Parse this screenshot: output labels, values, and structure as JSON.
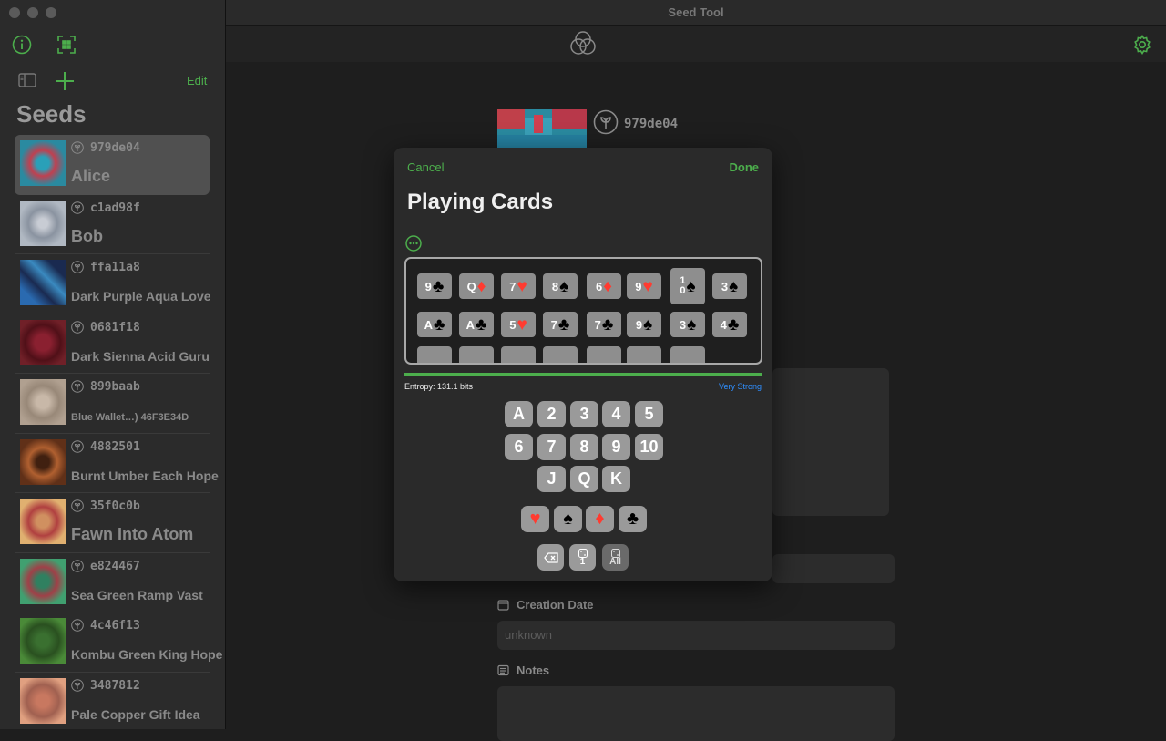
{
  "window": {
    "title": "Seed Tool"
  },
  "sidebar": {
    "edit_label": "Edit",
    "title": "Seeds",
    "items": [
      {
        "id": "979de04",
        "name": "Alice",
        "selected": true,
        "size": "big"
      },
      {
        "id": "c1ad98f",
        "name": "Bob",
        "size": "big"
      },
      {
        "id": "ffa11a8",
        "name": "Dark Purple Aqua Love",
        "size": "normal"
      },
      {
        "id": "0681f18",
        "name": "Dark Sienna Acid Guru",
        "size": "normal"
      },
      {
        "id": "899baab",
        "name": "Blue Wallet…) 46F3E34D",
        "size": "small"
      },
      {
        "id": "4882501",
        "name": "Burnt Umber Each Hope",
        "size": "normal"
      },
      {
        "id": "35f0c0b",
        "name": "Fawn Into Atom",
        "size": "big"
      },
      {
        "id": "e824467",
        "name": "Sea Green Ramp Vast",
        "size": "normal"
      },
      {
        "id": "4c46f13",
        "name": "Kombu Green King Hope",
        "size": "normal"
      },
      {
        "id": "3487812",
        "name": "Pale Copper Gift Idea",
        "size": "normal"
      }
    ]
  },
  "detail": {
    "seed_id": "979de04",
    "creation_date_label": "Creation Date",
    "creation_date_value": "unknown",
    "notes_label": "Notes"
  },
  "sheet": {
    "cancel_label": "Cancel",
    "done_label": "Done",
    "title": "Playing Cards",
    "entropy_text": "Entropy: 131.1 bits",
    "strength_text": "Very Strong",
    "strength_fraction": 1.0,
    "cards_row1": [
      {
        "rank": "9",
        "suit": "♣",
        "color": "black"
      },
      {
        "rank": "Q",
        "suit": "♦",
        "color": "red"
      },
      {
        "rank": "7",
        "suit": "♥",
        "color": "red"
      },
      {
        "rank": "8",
        "suit": "♠",
        "color": "black"
      },
      {
        "rank": "6",
        "suit": "♦",
        "color": "red"
      },
      {
        "rank": "9",
        "suit": "♥",
        "color": "red"
      },
      {
        "rank": "10",
        "suit": "♠",
        "color": "black"
      },
      {
        "rank": "3",
        "suit": "♠",
        "color": "black"
      }
    ],
    "cards_row2": [
      {
        "rank": "A",
        "suit": "♣",
        "color": "black"
      },
      {
        "rank": "A",
        "suit": "♣",
        "color": "black"
      },
      {
        "rank": "5",
        "suit": "♥",
        "color": "red"
      },
      {
        "rank": "7",
        "suit": "♣",
        "color": "black"
      },
      {
        "rank": "7",
        "suit": "♣",
        "color": "black"
      },
      {
        "rank": "9",
        "suit": "♠",
        "color": "black"
      },
      {
        "rank": "3",
        "suit": "♠",
        "color": "black"
      },
      {
        "rank": "4",
        "suit": "♣",
        "color": "black"
      }
    ],
    "rank_keys": [
      "A",
      "2",
      "3",
      "4",
      "5",
      "6",
      "7",
      "8",
      "9",
      "10",
      "J",
      "Q",
      "K"
    ],
    "suit_keys": [
      {
        "suit": "♥",
        "color": "red"
      },
      {
        "suit": "♠",
        "color": "black"
      },
      {
        "suit": "♦",
        "color": "red"
      },
      {
        "suit": "♣",
        "color": "black"
      }
    ],
    "util_keys": {
      "random_one": "1",
      "random_all": "All"
    }
  },
  "colors": {
    "accent": "#4cae4c",
    "strength": "#2f8fff",
    "red_suit": "#ff3b30"
  }
}
